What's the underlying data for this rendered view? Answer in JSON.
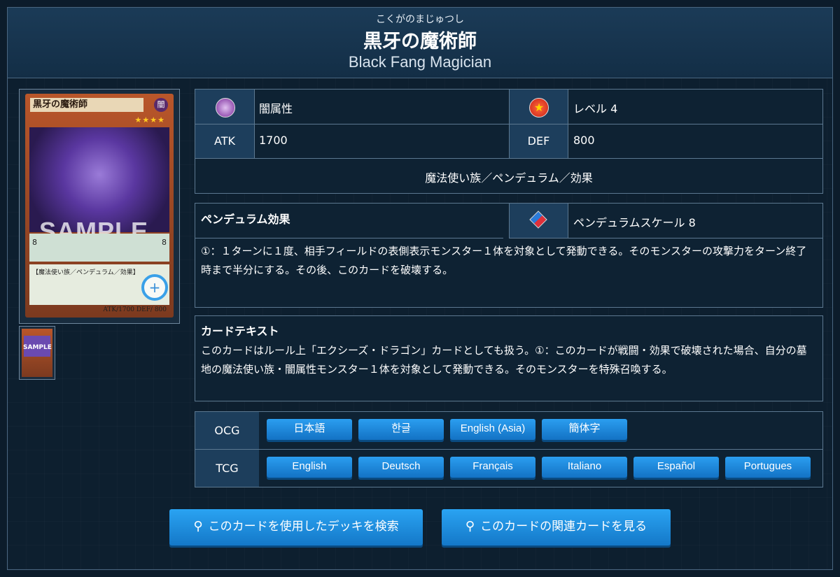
{
  "card": {
    "ruby": "こくがのまじゅつし",
    "name_jp": "黒牙の魔術師",
    "name_en": "Black Fang Magician"
  },
  "card_image": {
    "title": "黒牙の魔術師",
    "attribute_glyph": "闇",
    "stars": "★★★★",
    "watermark": "SAMPLE",
    "scale_left": "8",
    "scale_right": "8",
    "type_line": "【魔法使い族／ペンデュラム／効果】",
    "atk_def": "ATK/1700  DEF/ 800",
    "zoom_icon": "zoom-in-icon"
  },
  "stats": {
    "attribute_icon": "attribute-dark-icon",
    "attribute": "闇属性",
    "level_icon": "level-star-icon",
    "level": "レベル 4",
    "atk_label": "ATK",
    "atk": "1700",
    "def_label": "DEF",
    "def": "800",
    "types": "魔法使い族／ペンデュラム／効果"
  },
  "pendulum": {
    "header": "ペンデュラム効果",
    "scale_icon": "pendulum-scale-icon",
    "scale": "ペンデュラムスケール 8",
    "text": "①：１ターンに１度、相手フィールドの表側表示モンスター１体を対象として発動できる。そのモンスターの攻撃力をターン終了時まで半分にする。その後、このカードを破壊する。"
  },
  "card_text": {
    "header": "カードテキスト",
    "text": "このカードはルール上「エクシーズ・ドラゴン」カードとしても扱う。①：このカードが戦闘・効果で破壊された場合、自分の墓地の魔法使い族・闇属性モンスター１体を対象として発動できる。そのモンスターを特殊召喚する。"
  },
  "languages": {
    "ocg_label": "OCG",
    "ocg": [
      "日本語",
      "한글",
      "English (Asia)",
      "簡体字"
    ],
    "tcg_label": "TCG",
    "tcg": [
      "English",
      "Deutsch",
      "Français",
      "Italiano",
      "Español",
      "Portugues"
    ]
  },
  "actions": {
    "deck_search": "このカードを使用したデッキを検索",
    "related": "このカードの関連カードを見る"
  },
  "colors": {
    "accent": "#1f8ee0",
    "header_bg": "#1b3b57",
    "label_bg": "#1d3e5c",
    "border": "#5c7890"
  }
}
